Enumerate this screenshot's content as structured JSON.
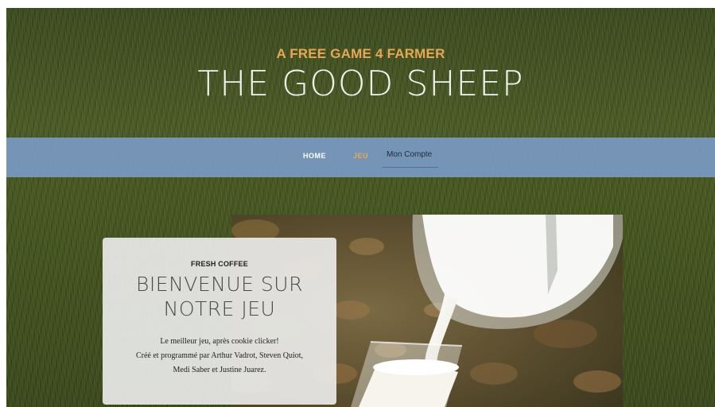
{
  "header": {
    "subtitle": "A FREE GAME 4 FARMER",
    "title": "THE GOOD SHEEP"
  },
  "nav": {
    "home": "HOME",
    "jeu": "JEU",
    "account": "Mon Compte",
    "active_color": "#e6a756",
    "bar_color": "#7899c2"
  },
  "intro": {
    "lower": "FRESH COFFEE",
    "upper_line1": "BIENVENUE SUR",
    "upper_line2": "NOTRE JEU",
    "text_line1": "Le meilleur jeu, après cookie clicker!",
    "text_line2": "Créé et programmé par Arthur Vadrot, Steven Quiot,",
    "text_line3": "Medi Saber et Justine Juarez."
  },
  "colors": {
    "accent": "#e6a756",
    "grass": "#455522"
  }
}
